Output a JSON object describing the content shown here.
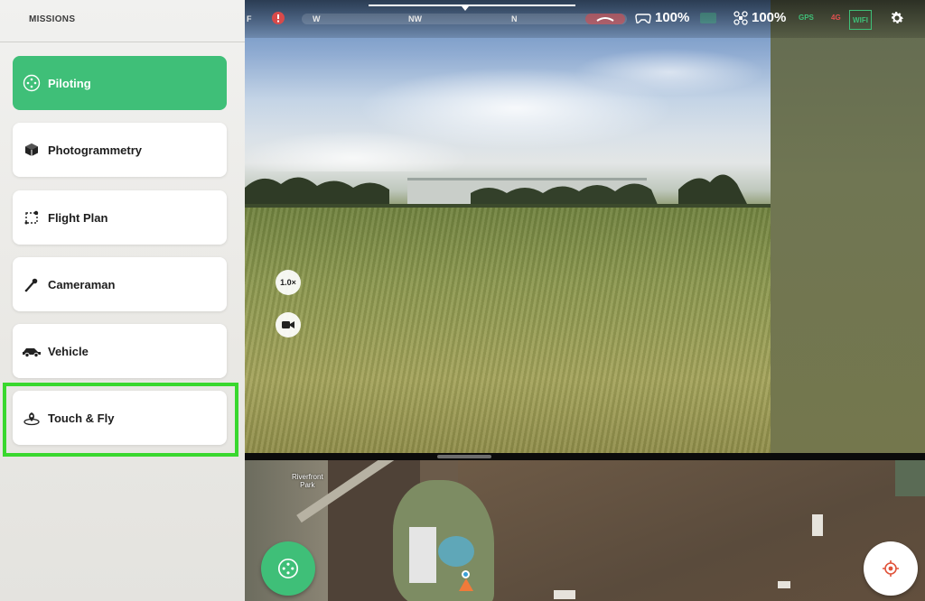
{
  "sidebar": {
    "header": "MISSIONS",
    "items": [
      {
        "label": "Piloting",
        "icon": "piloting-icon",
        "active": true
      },
      {
        "label": "Photogrammetry",
        "icon": "cube-icon",
        "active": false
      },
      {
        "label": "Flight Plan",
        "icon": "flight-plan-icon",
        "active": false
      },
      {
        "label": "Cameraman",
        "icon": "cameraman-icon",
        "active": false
      },
      {
        "label": "Vehicle",
        "icon": "vehicle-icon",
        "active": false
      },
      {
        "label": "Touch & Fly",
        "icon": "touch-fly-icon",
        "active": false
      }
    ],
    "highlighted_item": "Touch & Fly"
  },
  "statusbar": {
    "compass": {
      "left": "F",
      "w": "W",
      "nw": "NW",
      "n": "N"
    },
    "controller_battery": "100%",
    "drone_battery": "100%",
    "gps_label": "GPS",
    "network_label": "4G",
    "wifi_label": "WIFI"
  },
  "video": {
    "zoom_label": "1.0×"
  },
  "map": {
    "place_label_line1": "Riverfront",
    "place_label_line2": "Park"
  },
  "colors": {
    "accent": "#3fbf78",
    "highlight": "#39d82e"
  }
}
